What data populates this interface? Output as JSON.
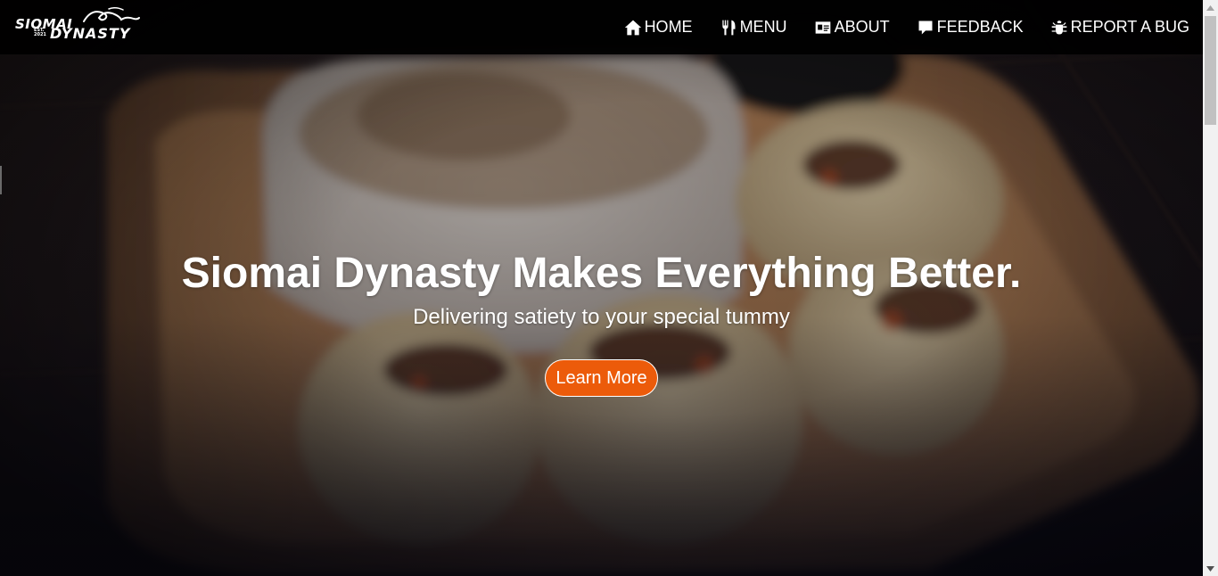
{
  "brand": {
    "name_top": "SIOMAI",
    "name_bottom": "DYNASTY",
    "est": "EST. 2021"
  },
  "nav": {
    "items": [
      {
        "label": "HOME",
        "icon": "home-icon"
      },
      {
        "label": "MENU",
        "icon": "utensils-icon"
      },
      {
        "label": "ABOUT",
        "icon": "id-card-icon"
      },
      {
        "label": "FEEDBACK",
        "icon": "comment-icon"
      },
      {
        "label": "REPORT A BUG",
        "icon": "bug-icon"
      }
    ]
  },
  "hero": {
    "title": "Siomai Dynasty Makes Everything Better.",
    "subtitle": "Delivering satiety to your special tummy",
    "cta_label": "Learn More"
  },
  "colors": {
    "navbar_bg": "#000000",
    "cta_bg": "#ec5b0a",
    "text": "#ffffff"
  }
}
